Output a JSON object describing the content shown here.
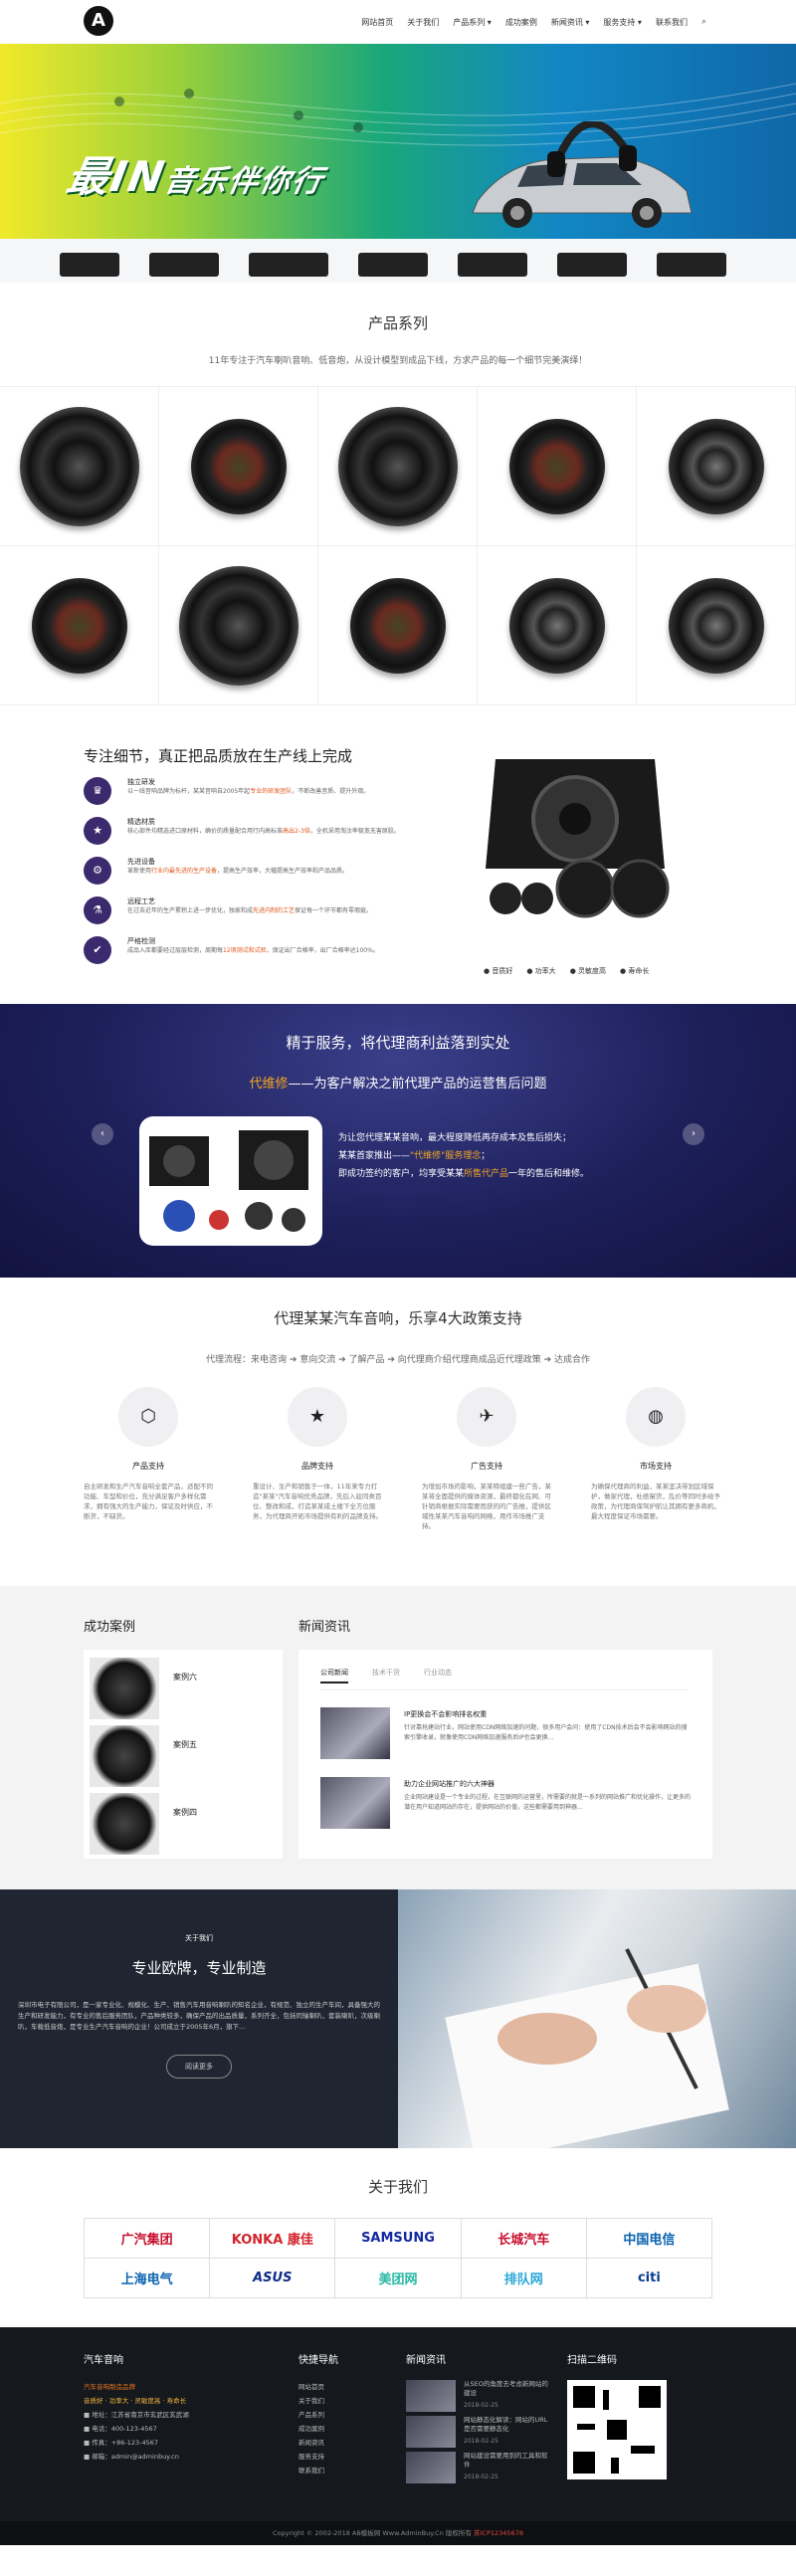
{
  "nav": {
    "logo_text": "A",
    "items": [
      "网站首页",
      "关于我们",
      "产品系列 ▾",
      "成功案例",
      "新闻资讯 ▾",
      "服务支持 ▾",
      "联系我们"
    ],
    "search_icon": "search-icon"
  },
  "banner": {
    "slogan_main": "最IN",
    "slogan_rest": "音乐伴你行"
  },
  "products": {
    "title": "产品系列",
    "subtitle": "11年专注于汽车喇叭音响、低音炮，从设计模型到成品下线，方求产品的每一个细节完美演绎！"
  },
  "focus": {
    "title": "专注细节，真正把品质放在生产线上完成",
    "features": [
      {
        "icon": "ribbon-icon",
        "title": "独立研发",
        "desc": "以一线音响品牌为标杆，某某音响自2005年起",
        "highlight": "专业的研发团队",
        "desc2": "，不断改善音质、提升外观。"
      },
      {
        "icon": "star-icon",
        "title": "精选材质",
        "desc": "核心部件均精选进口原材料，确价的质量配合用行内高标准",
        "highlight": "高出2-3倍",
        "desc2": "，全机采用淘汰率极宽无害原胶。"
      },
      {
        "icon": "gear-icon",
        "title": "先进设备",
        "desc": "革新使用",
        "highlight": "行业内最先进的生产设备",
        "desc2": "，提高生产效率，大幅提高生产效率和产品品质。"
      },
      {
        "icon": "flask-icon",
        "title": "远程工艺",
        "desc": "在过去近年的生产累积上进一步优化，独家和成",
        "highlight": "先进内制的工艺",
        "desc2": "保证每一个环节都有零瑕疵。"
      },
      {
        "icon": "check-icon",
        "title": "严格检测",
        "desc": "成品入库都要经过层层检测，周期每",
        "highlight": "12项测试和试验",
        "desc2": "，保证出厂合格率，出厂合格率达100%。"
      }
    ],
    "legend": [
      "● 音质好",
      "● 功率大",
      "● 灵敏度高",
      "● 寿命长"
    ]
  },
  "agent": {
    "title": "精于服务，将代理商利益落到实处",
    "highlight": "代维修",
    "line2": "——为客户解决之前代理产品的运营售后问题",
    "text1": "为让您代理某某音响，最大程度降低再存成本及售后损失；",
    "text2_a": "某某首家推出——",
    "text2_b": "\"代维修\"服务理念",
    "text2_c": "；",
    "text3_a": "即成功签约的客户，均享受某某",
    "text3_b": "所售代产品",
    "text3_c": "一年的售后和维修。",
    "prev": "‹",
    "next": "›"
  },
  "policy": {
    "title": "代理某某汽车音响，乐享4大政策支持",
    "flow": "代理流程：来电咨询 ➔ 意向交流 ➔ 了解产品 ➔ 向代理商介绍代理商成品近代理政策 ➔ 达成合作",
    "cols": [
      {
        "icon": "cubes-icon",
        "glyph": "⬡",
        "title": "产品支持",
        "desc": "自主研发和生产汽车音响全套产品，适配不同功能、车型和价位，充分满足客户多样化需求，拥有强大的生产能力，保证及时供应，不断货，不缺货。"
      },
      {
        "icon": "star-icon",
        "glyph": "★",
        "title": "品牌支持",
        "desc": "重设计、生产和销售于一体，11年来专力打造\"某某\"汽车音响优秀品牌，先后入驻同类百位、整改和成，打造某某成土楼下全方位服务，为代理商开拓市场提供有利的品牌支持。"
      },
      {
        "icon": "send-icon",
        "glyph": "✈",
        "title": "广告支持",
        "desc": "为增加市场的影响，某某特组建一些广告，某某将全面提供的媒体资源，最终都化在网、可针销商根据实际需要而获的的广告推，提供区域性某某汽车音响的网络，用作市场推广支持。"
      },
      {
        "icon": "globe-icon",
        "glyph": "◍",
        "title": "市场支持",
        "desc": "为确保代理商的利益，某某坚决带划区域保护，做家代理，杜绝窜货，乱价等同时多给予政策，为代理商保驾护航让其拥有更多商机，最大程度保证市场需要。"
      }
    ]
  },
  "cases": {
    "title": "成功案例",
    "items": [
      "案例六",
      "案例五",
      "案例四"
    ]
  },
  "news": {
    "title": "新闻资讯",
    "tabs": [
      "公司新闻",
      "技术干货",
      "行业动态"
    ],
    "items": [
      {
        "title": "IP更换会不会影响排名权重",
        "desc": "针对靠抢建站行业，网站使用CDN网络加速的问题，很多用户会问：使用了CDN技术后会不会影响网站的搜索引擎收录，就像使用CDN网络加速服务后IP也会更换..."
      },
      {
        "title": "助力企业网站推广的六大神器",
        "desc": "企业网站建设是一个专业的过程，在互联网的运营里，所需要的就是一系列的网站推广和优化操作，让更多的潜在用户知道网站的存在，提供网站的价值，这些都需要用到神器..."
      }
    ]
  },
  "about": {
    "label": "关于我们",
    "title": "专业欧牌，专业制造",
    "desc": "深圳市电子有限公司，是一家专业化、规模化、生产、销售汽车用音响喇叭的知名企业，有规范、独立的生产车间，具备强大的生产和研发能力，有专业的售后服务团队，产品种类较多，确保产品的出品质量，系列齐全，包括同轴喇叭，套装喇叭，次级喇叭，车载低音炮，是专业生产汽车音响的企业！公司成立于2005年6月，旗下...",
    "button": "阅读更多"
  },
  "partners": {
    "title": "关于我们",
    "logos": [
      {
        "name": "广汽集团",
        "color": "#c8102e"
      },
      {
        "name": "KONKA 康佳",
        "color": "#d2232a"
      },
      {
        "name": "SAMSUNG",
        "color": "#1428a0"
      },
      {
        "name": "长城汽车",
        "color": "#c8102e"
      },
      {
        "name": "中国电信",
        "color": "#0b63b0"
      },
      {
        "name": "上海电气",
        "color": "#0b63b0"
      },
      {
        "name": "ASUS",
        "color": "#0f2c8a"
      },
      {
        "name": "美团网",
        "color": "#29b8a5"
      },
      {
        "name": "排队网",
        "color": "#29a7d6"
      },
      {
        "name": "citi",
        "color": "#0a3d91"
      }
    ]
  },
  "footer": {
    "brand": "汽车音响",
    "brand_sub": "汽车音响制造品牌",
    "slogan": "音质好 · 功率大 · 灵敏度高 · 寿命长",
    "address": "■ 地址：江苏省南京市玄武区玄武湖",
    "phone": "■ 电话：400-123-4567",
    "mobile": "■ 传真：+86-123-4567",
    "email": "■ 邮箱：admin@adminbuy.cn",
    "quick_title": "快捷导航",
    "quick": [
      "网站首页",
      "关于我们",
      "产品系列",
      "成功案例",
      "新闻资讯",
      "服务支持",
      "联系我们"
    ],
    "news_title": "新闻资讯",
    "news": [
      {
        "title": "从SEO的角度去考虑新网站的建设",
        "date": "2018-02-25"
      },
      {
        "title": "网站静态化解读：网站的URL是否需要静态化",
        "date": "2018-02-25"
      },
      {
        "title": "网站建设需要用到的工具和软件",
        "date": "2018-02-25"
      }
    ],
    "qr_title": "扫描二维码",
    "copyright_a": "Copyright © 2002-2018 AB模板网 Www.AdminBuy.Cn 版权所有",
    "copyright_b": "苏ICP12345678"
  }
}
